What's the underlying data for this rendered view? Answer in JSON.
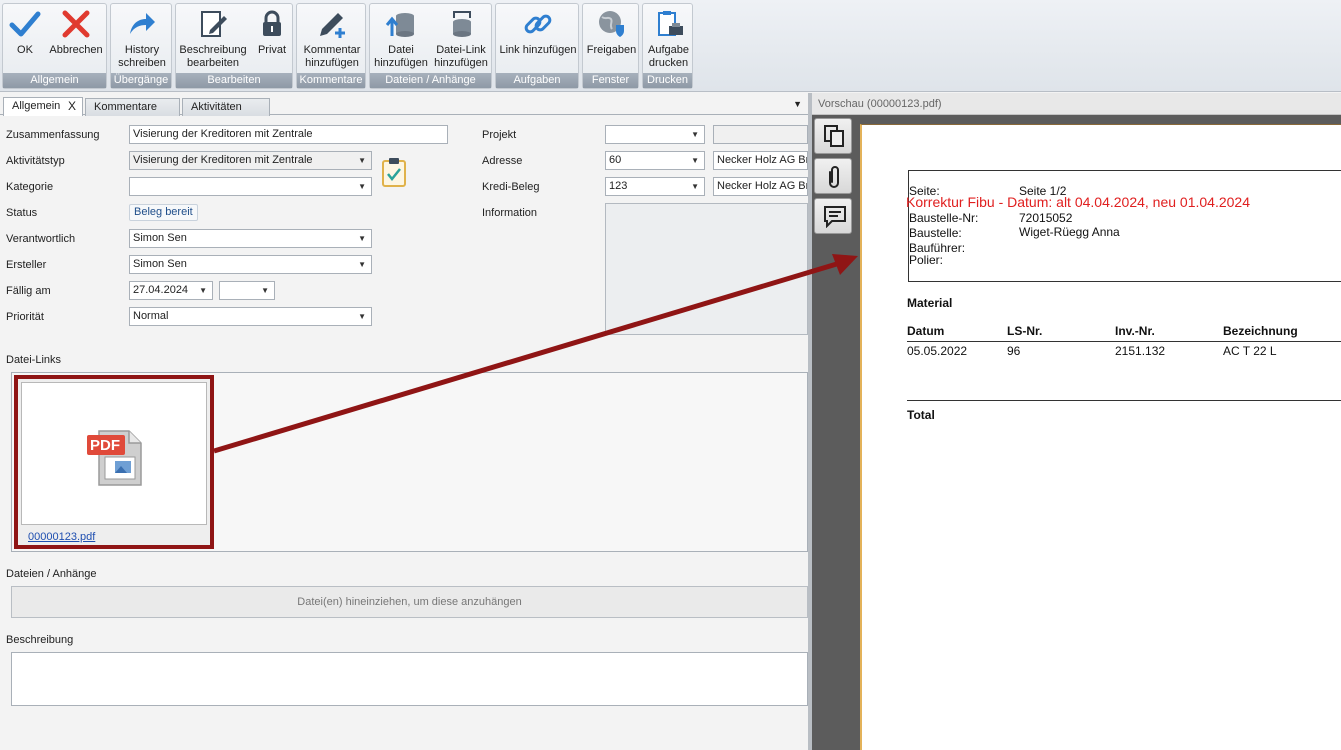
{
  "ribbon": {
    "groups": [
      {
        "label": "Allgemein",
        "buttons": [
          {
            "label": "OK"
          },
          {
            "label": "Abbrechen"
          }
        ]
      },
      {
        "label": "Übergänge",
        "buttons": [
          {
            "label": "History\nschreiben"
          }
        ]
      },
      {
        "label": "Bearbeiten",
        "buttons": [
          {
            "label": "Beschreibung\nbearbeiten"
          },
          {
            "label": "Privat"
          }
        ]
      },
      {
        "label": "Kommentare",
        "buttons": [
          {
            "label": "Kommentar\nhinzufügen"
          }
        ]
      },
      {
        "label": "Dateien / Anhänge",
        "buttons": [
          {
            "label": "Datei\nhinzufügen"
          },
          {
            "label": "Datei-Link\nhinzufügen"
          }
        ]
      },
      {
        "label": "Aufgaben",
        "buttons": [
          {
            "label": "Link hinzufügen"
          }
        ]
      },
      {
        "label": "Fenster",
        "buttons": [
          {
            "label": "Freigaben"
          }
        ]
      },
      {
        "label": "Drucken",
        "buttons": [
          {
            "label": "Aufgabe\ndrucken"
          }
        ]
      }
    ]
  },
  "tabs": [
    {
      "label": "Allgemein",
      "close": "X"
    },
    {
      "label": "Kommentare"
    },
    {
      "label": "Aktivitäten"
    }
  ],
  "form": {
    "zusammenfassung": {
      "label": "Zusammenfassung",
      "value": "Visierung der Kreditoren mit Zentrale"
    },
    "aktivitaetstyp": {
      "label": "Aktivitätstyp",
      "value": "Visierung der Kreditoren mit Zentrale"
    },
    "kategorie": {
      "label": "Kategorie",
      "value": ""
    },
    "status": {
      "label": "Status",
      "value": "Beleg bereit"
    },
    "verantwortlich": {
      "label": "Verantwortlich",
      "value": "Simon Sen"
    },
    "ersteller": {
      "label": "Ersteller",
      "value": "Simon Sen"
    },
    "faellig": {
      "label": "Fällig am",
      "date": "27.04.2024",
      "time": ""
    },
    "prioritaet": {
      "label": "Priorität",
      "value": "Normal"
    },
    "projekt": {
      "label": "Projekt",
      "value": "",
      "extra": ""
    },
    "adresse": {
      "label": "Adresse",
      "value": "60",
      "extra": "Necker Holz AG Bru"
    },
    "kredibeleg": {
      "label": "Kredi-Beleg",
      "value": "123",
      "extra": "Necker Holz AG Bru"
    },
    "information": {
      "label": "Information"
    }
  },
  "sections": {
    "datei_links": "Datei-Links",
    "dateien": "Dateien / Anhänge",
    "beschreibung": "Beschreibung"
  },
  "file_link": {
    "name": "00000123.pdf",
    "icon_text": "PDF"
  },
  "drop_hint": "Datei(en) hineinziehen, um diese anzuhängen",
  "preview": {
    "title": "Vorschau (00000123.pdf)",
    "annotation": "Korrektur Fibu - Datum: alt 04.04.2024, neu 01.04.2024",
    "header": {
      "seite_label": "Seite:",
      "seite_value": "Seite 1/2",
      "baustelle_nr_label": "Baustelle-Nr:",
      "baustelle_nr_value": "72015052",
      "baustelle_label": "Baustelle:",
      "baustelle_value": "Wiget-Rüegg Anna",
      "baufuehrer_label": "Bauführer:",
      "polier_label": "Polier:"
    },
    "material_heading": "Material",
    "table": {
      "headers": [
        "Datum",
        "LS-Nr.",
        "Inv.-Nr.",
        "Bezeichnung"
      ],
      "rows": [
        [
          "05.05.2022",
          "96",
          "2151.132",
          "AC T 22 L"
        ]
      ]
    },
    "total_label": "Total"
  },
  "colors": {
    "highlight": "#8f1515",
    "annotation": "#e02020",
    "ok_check": "#2f7fd0",
    "cancel_x": "#e03a2f"
  }
}
